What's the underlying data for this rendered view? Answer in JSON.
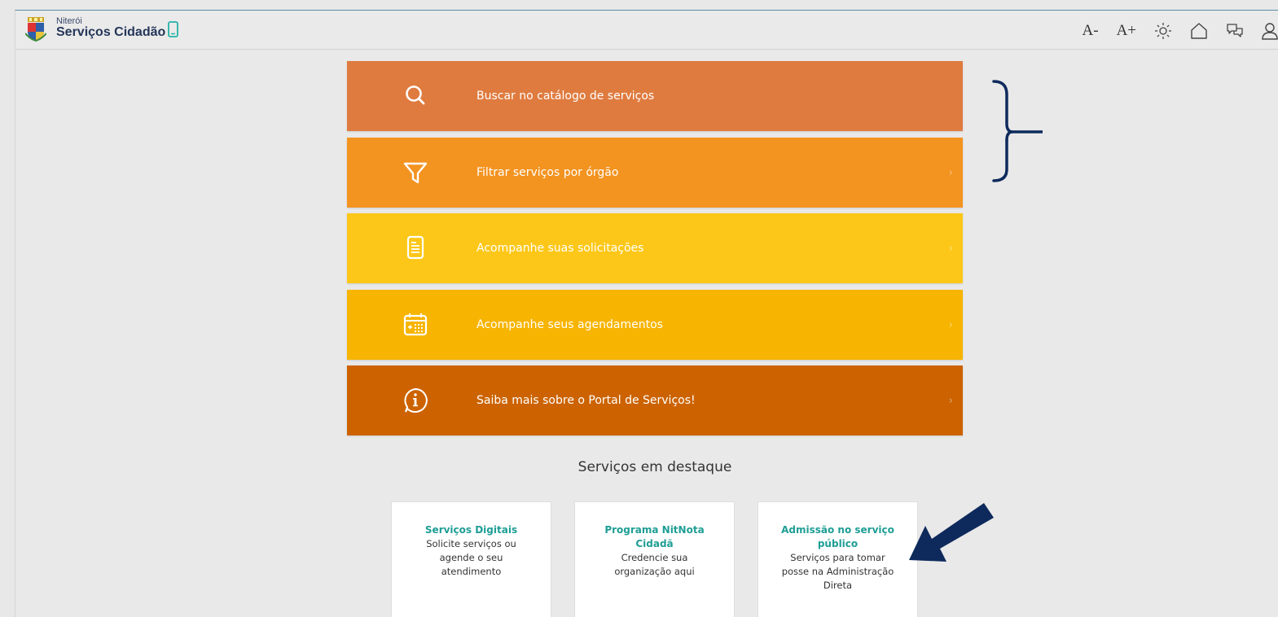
{
  "header": {
    "city": "Niterói",
    "site_name": "Serviços Cidadão",
    "tools": {
      "font_decrease": "A-",
      "font_increase": "A+",
      "contrast_icon": "sun-icon",
      "home_icon": "home-icon",
      "chat_icon": "chat-icon",
      "user_icon": "user-icon"
    }
  },
  "menu": [
    {
      "label": "Buscar no catálogo de serviços",
      "icon": "search-icon",
      "color": "#df7b3f"
    },
    {
      "label": "Filtrar serviços por órgão",
      "icon": "filter-icon",
      "color": "#f39320"
    },
    {
      "label": "Acompanhe suas solicitações",
      "icon": "document-icon",
      "color": "#fcc718"
    },
    {
      "label": "Acompanhe seus agendamentos",
      "icon": "calendar-icon",
      "color": "#f7b400"
    },
    {
      "label": "Saiba mais sobre o Portal de Serviços!",
      "icon": "info-icon",
      "color": "#cc6300"
    }
  ],
  "featured": {
    "title": "Serviços em destaque",
    "cards": [
      {
        "title": "Serviços Digitais",
        "desc": "Solicite serviços ou agende o seu atendimento"
      },
      {
        "title": "Programa NitNota Cidadã",
        "desc": "Credencie sua organização aqui"
      },
      {
        "title": "Admissão no serviço público",
        "desc": "Serviços para tomar posse na Administração Direta"
      }
    ]
  },
  "annotation_color": "#0e2a5c"
}
